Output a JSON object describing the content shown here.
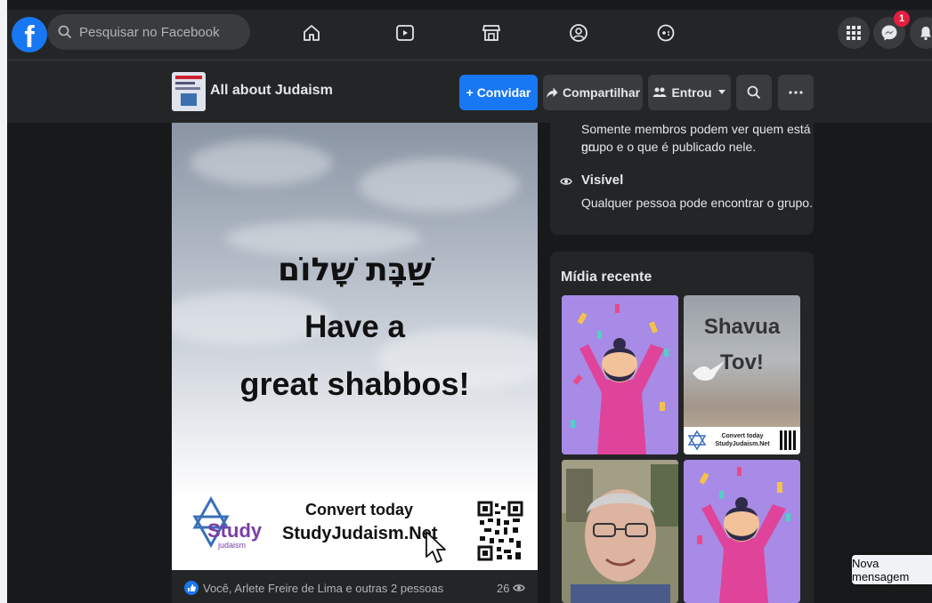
{
  "topbar": {
    "search_placeholder": "Pesquisar no Facebook",
    "messenger_badge": "1"
  },
  "group": {
    "name": "All about Judaism",
    "invite_label": "+ Convidar",
    "share_label": "Compartilhar",
    "joined_label": "Entrou"
  },
  "post": {
    "hebrew_text": "שַׁבָּת שָׁלוֹם",
    "line2": "Have a",
    "line3": "great shabbos!",
    "convert_line1": "Convert today",
    "convert_line2": "StudyJudaism.Net",
    "logo_word": "Study",
    "logo_sub": "judaism",
    "reactions_text": "Você, Arlete Freire de Lima e outras 2 pessoas",
    "views_count": "26"
  },
  "about": {
    "private_desc_line1": "Somente membros podem ver quem está no",
    "private_desc_line2": "grupo e o que é publicado nele.",
    "visible_title": "Visível",
    "visible_desc": "Qualquer pessoa pode encontrar o grupo."
  },
  "media": {
    "title": "Mídia recente",
    "shavua_line1": "Shavua",
    "shavua_line2": "Tov!",
    "shavua_footer": "Convert today StudyJudaism.Net"
  },
  "chat": {
    "new_message": "Nova mensagem"
  },
  "colors": {
    "brand": "#1877f2",
    "background": "#18191a",
    "surface": "#242526"
  }
}
